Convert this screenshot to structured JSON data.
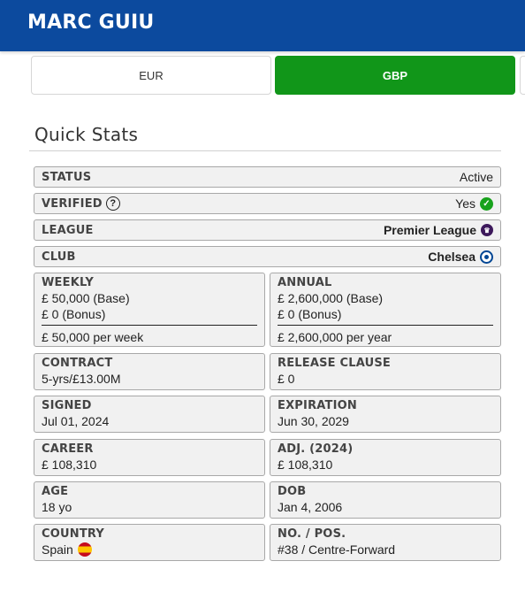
{
  "header": {
    "title": "MARC GUIU"
  },
  "currency": {
    "options": [
      {
        "label": "EUR",
        "active": false
      },
      {
        "label": "GBP",
        "active": true
      }
    ],
    "active_color": "#119619"
  },
  "section": {
    "title": "Quick Stats"
  },
  "rows": {
    "status": {
      "label": "STATUS",
      "value": "Active"
    },
    "verified": {
      "label": "VERIFIED",
      "help_icon": "question-circle-icon",
      "value": "Yes",
      "icon": "check-circle-icon"
    },
    "league": {
      "label": "LEAGUE",
      "value": "Premier League",
      "icon": "premier-league-logo-icon"
    },
    "club": {
      "label": "CLUB",
      "value": "Chelsea",
      "icon": "chelsea-crest-icon"
    }
  },
  "weekly": {
    "label": "WEEKLY",
    "base": "£ 50,000 (Base)",
    "bonus": "£ 0 (Bonus)",
    "total": "£ 50,000 per week"
  },
  "annual": {
    "label": "ANNUAL",
    "base": "£ 2,600,000 (Base)",
    "bonus": "£ 0 (Bonus)",
    "total": "£ 2,600,000 per year"
  },
  "contract": {
    "label": "CONTRACT",
    "value": "5-yrs/£13.00M"
  },
  "release_clause": {
    "label": "RELEASE CLAUSE",
    "value": "£ 0"
  },
  "signed": {
    "label": "SIGNED",
    "value": "Jul 01, 2024"
  },
  "expiration": {
    "label": "EXPIRATION",
    "value": "Jun 30, 2029"
  },
  "career": {
    "label": "CAREER",
    "value": "£ 108,310"
  },
  "adjusted": {
    "label": "ADJ. (2024)",
    "value": "£ 108,310"
  },
  "age": {
    "label": "AGE",
    "value": "18 yo"
  },
  "dob": {
    "label": "DOB",
    "value": "Jan 4, 2006"
  },
  "country": {
    "label": "COUNTRY",
    "value": "Spain",
    "icon": "spain-flag-icon"
  },
  "number_position": {
    "label": "NO. / POS.",
    "value": "#38 / Centre-Forward"
  },
  "colors": {
    "header_bg": "#0c4a9e",
    "active_button": "#119619",
    "panel_bg": "#f1f1f1"
  }
}
